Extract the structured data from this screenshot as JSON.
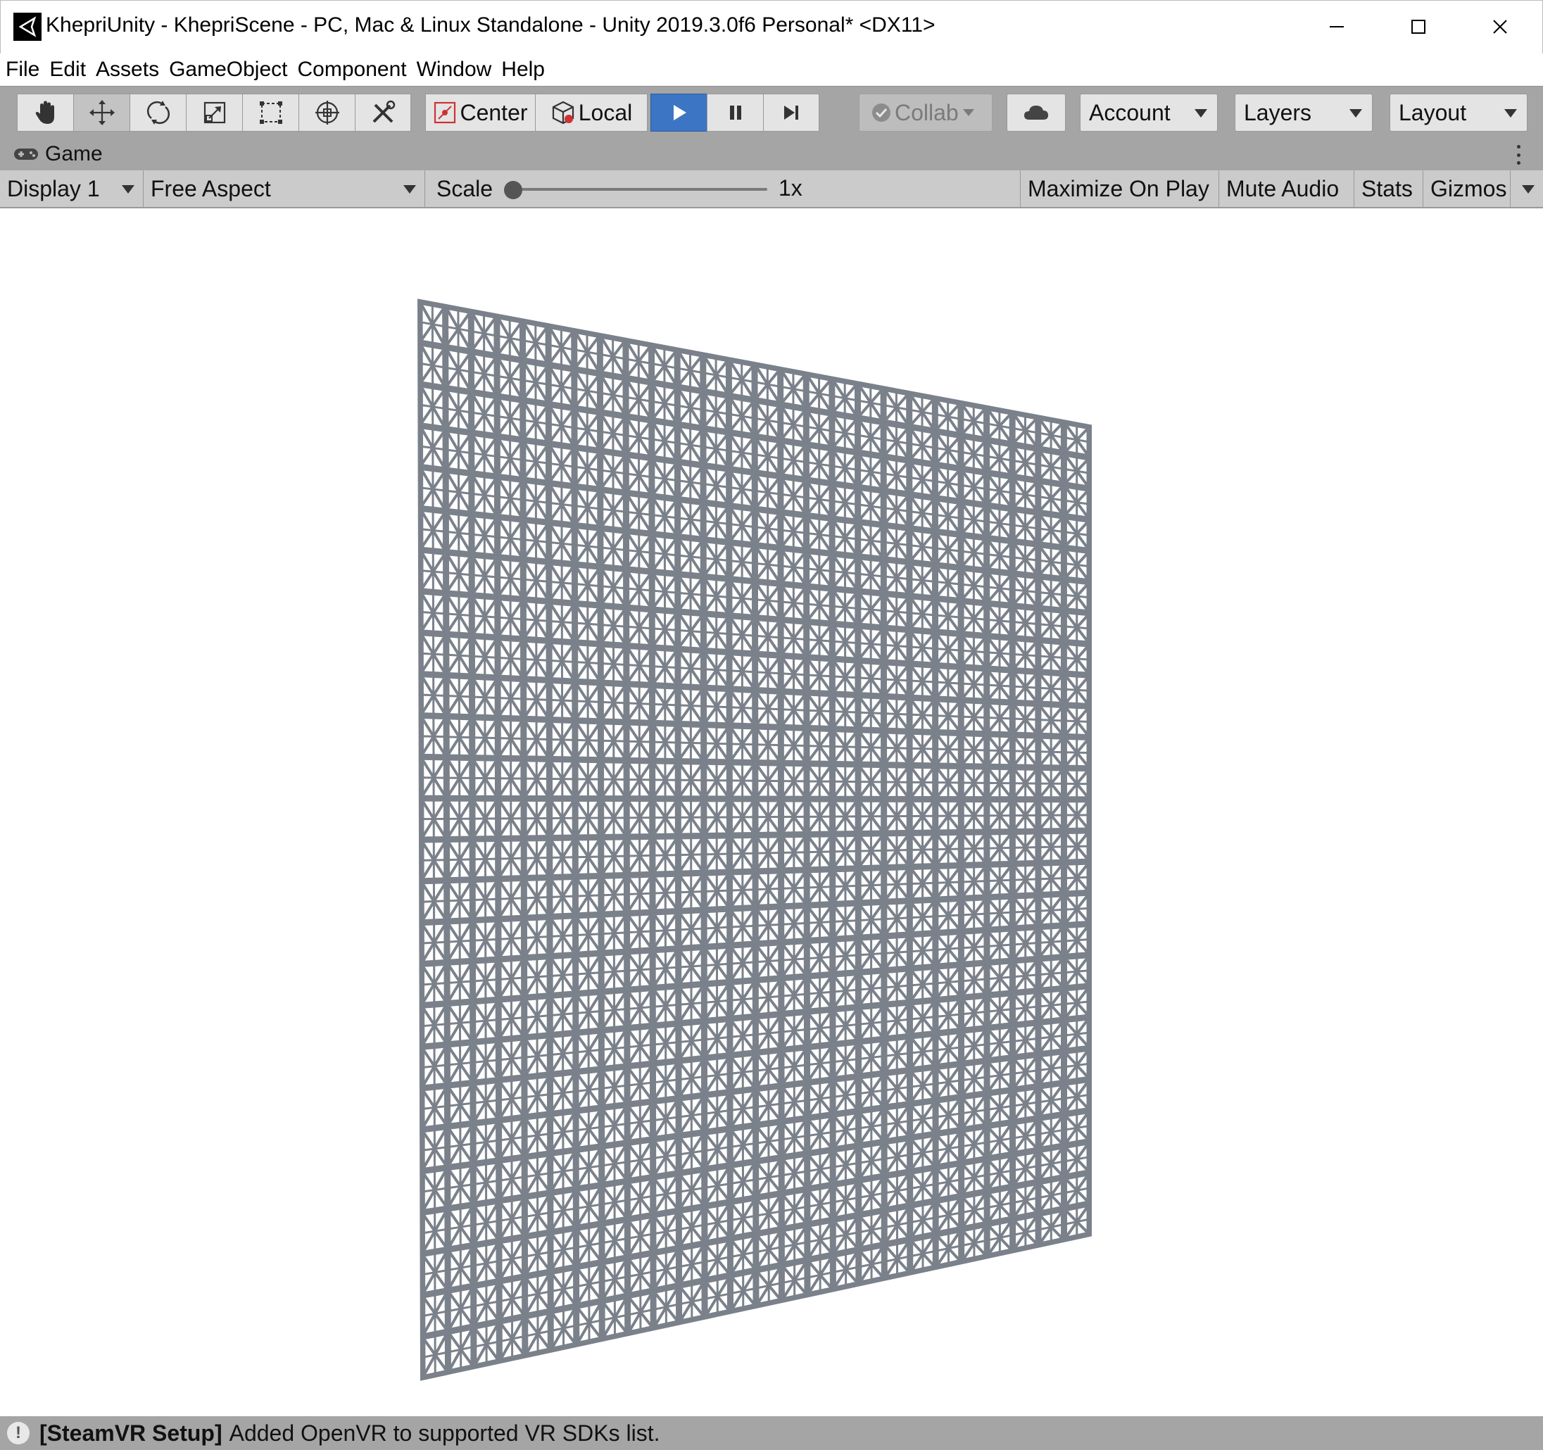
{
  "window": {
    "title": "KhepriUnity - KhepriScene - PC, Mac & Linux Standalone - Unity 2019.3.0f6 Personal* <DX11>",
    "app_icon": "unity-logo-icon",
    "controls": [
      "minimize-icon",
      "maximize-icon",
      "close-icon"
    ]
  },
  "menu": {
    "items": [
      "File",
      "Edit",
      "Assets",
      "GameObject",
      "Component",
      "Window",
      "Help"
    ]
  },
  "toolbar": {
    "transform_tools": [
      {
        "icon": "hand-tool-icon",
        "active": false
      },
      {
        "icon": "move-tool-icon",
        "active": true
      },
      {
        "icon": "rotate-tool-icon",
        "active": false
      },
      {
        "icon": "scale-tool-icon",
        "active": false
      },
      {
        "icon": "rect-tool-icon",
        "active": false
      },
      {
        "icon": "transform-tool-icon",
        "active": false
      },
      {
        "icon": "custom-tool-icon",
        "active": false
      }
    ],
    "pivot_label": "Center",
    "space_label": "Local",
    "playback": [
      {
        "icon": "play-icon",
        "active": true
      },
      {
        "icon": "pause-icon",
        "active": false
      },
      {
        "icon": "step-icon",
        "active": false
      }
    ],
    "collab_label": "Collab",
    "cloud_icon": "cloud-icon",
    "account_label": "Account",
    "layers_label": "Layers",
    "layout_label": "Layout",
    "play_color": "#3c75c4"
  },
  "game_view": {
    "tab_label": "Game",
    "tab_icon": "gamepad-icon",
    "display": "Display 1",
    "aspect": "Free Aspect",
    "scale_label": "Scale",
    "scale_value": "1x",
    "maximize_on_play": "Maximize On Play",
    "mute_audio": "Mute Audio",
    "stats": "Stats",
    "gizmos": "Gizmos",
    "lattice_color": "#7b818a",
    "background_color": "#ffffff"
  },
  "status": {
    "icon": "info-icon",
    "prefix": "[SteamVR Setup]",
    "message": "Added OpenVR to supported VR SDKs list."
  }
}
